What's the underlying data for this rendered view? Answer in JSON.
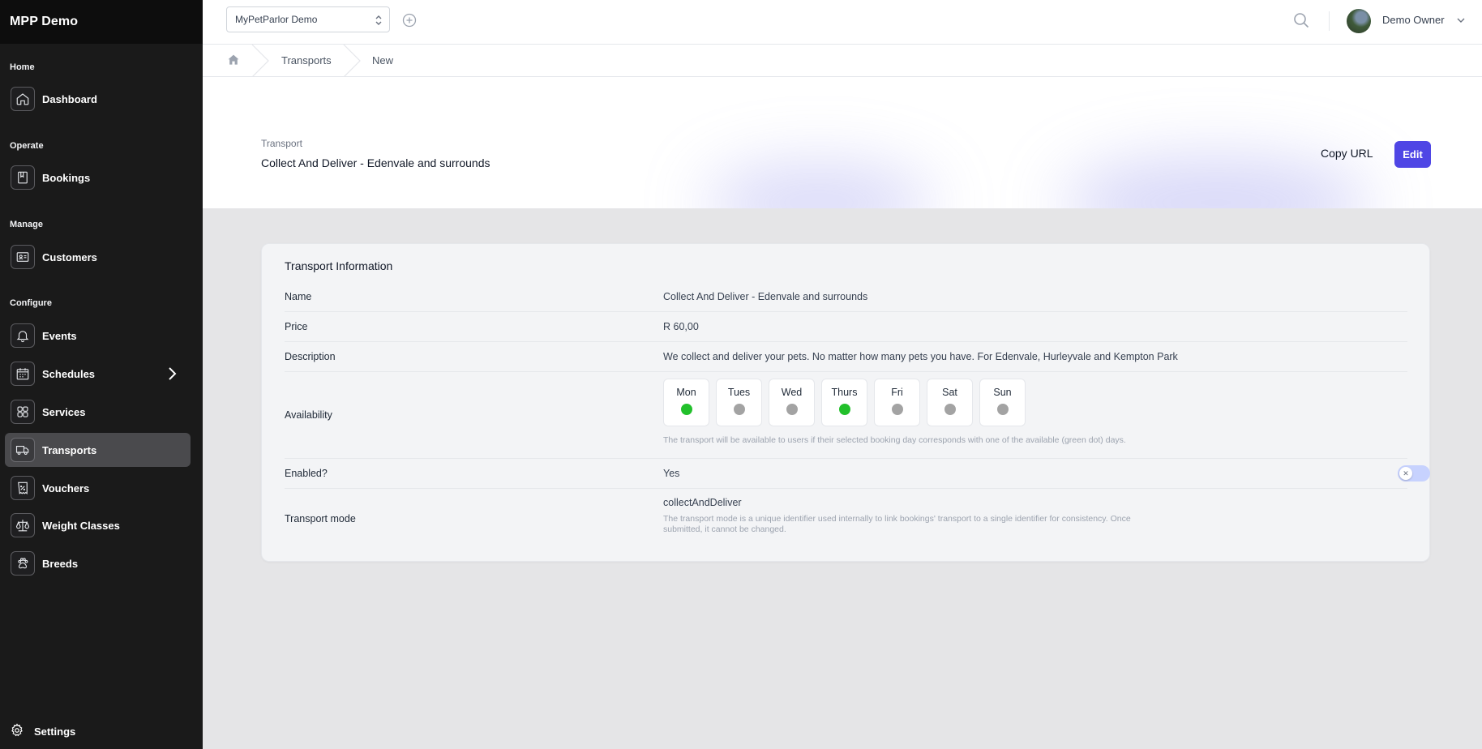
{
  "app": {
    "brand": "MPP Demo"
  },
  "sidebar": {
    "sections": {
      "home": "Home",
      "operate": "Operate",
      "manage": "Manage",
      "configure": "Configure"
    },
    "items": [
      {
        "label": "Dashboard",
        "icon": "home-icon"
      },
      {
        "label": "Bookings",
        "icon": "book-icon"
      },
      {
        "label": "Customers",
        "icon": "contact-card-icon"
      },
      {
        "label": "Events",
        "icon": "bell-icon"
      },
      {
        "label": "Schedules",
        "icon": "calendar-icon"
      },
      {
        "label": "Services",
        "icon": "grid-icon"
      },
      {
        "label": "Transports",
        "icon": "truck-icon",
        "active": true
      },
      {
        "label": "Vouchers",
        "icon": "voucher-icon"
      },
      {
        "label": "Weight Classes",
        "icon": "scale-icon"
      },
      {
        "label": "Breeds",
        "icon": "paw-icon"
      }
    ],
    "settings_label": "Settings"
  },
  "topbar": {
    "org_selected": "MyPetParlor Demo",
    "user_name": "Demo Owner"
  },
  "breadcrumb": {
    "items": [
      "Transports",
      "New"
    ]
  },
  "header": {
    "subtitle": "Transport",
    "title": "Collect And Deliver - Edenvale and surrounds",
    "copy_url_label": "Copy URL",
    "edit_label": "Edit"
  },
  "card": {
    "title": "Transport Information",
    "name_label": "Name",
    "name_value": "Collect And Deliver - Edenvale and surrounds",
    "price_label": "Price",
    "price_value": "R 60,00",
    "description_label": "Description",
    "description_value": "We collect and deliver your pets. No matter how many pets you have. For Edenvale, Hurleyvale and Kempton Park",
    "availability_label": "Availability",
    "days": [
      {
        "name": "Mon",
        "available": true
      },
      {
        "name": "Tues",
        "available": false
      },
      {
        "name": "Wed",
        "available": false
      },
      {
        "name": "Thurs",
        "available": true
      },
      {
        "name": "Fri",
        "available": false
      },
      {
        "name": "Sat",
        "available": false
      },
      {
        "name": "Sun",
        "available": false
      }
    ],
    "availability_hint": "The transport will be available to users if their selected booking day corresponds with one of the available (green dot) days.",
    "enabled_label": "Enabled?",
    "enabled_value": "Yes",
    "enabled_toggle": false,
    "mode_label": "Transport mode",
    "mode_value": "collectAndDeliver",
    "mode_hint": "The transport mode is a unique identifier used internally to link bookings' transport to a single identifier for consistency. Once submitted, it cannot be changed."
  },
  "colors": {
    "accent": "#4f46e5",
    "sidebar_bg": "#1a1a1a",
    "available_dot": "#22c02b",
    "unavailable_dot": "#a3a3a3"
  }
}
